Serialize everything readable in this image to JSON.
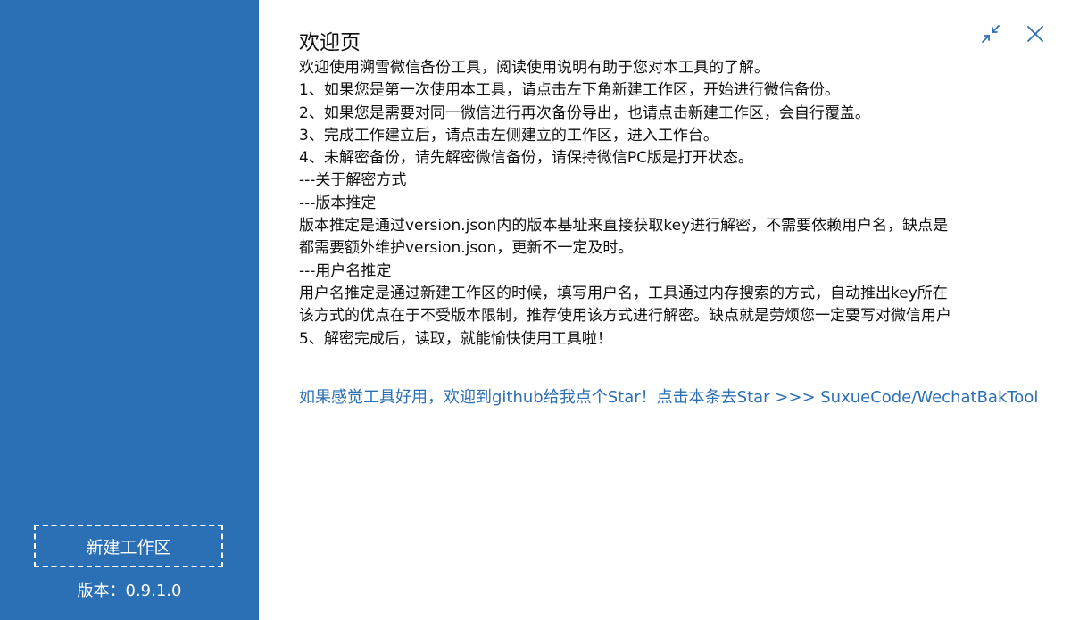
{
  "sidebar": {
    "new_workspace_label": "新建工作区",
    "version_label": "版本：",
    "version_value": "0.9.1.0"
  },
  "main": {
    "title": "欢迎页",
    "lines": [
      "欢迎使用溯雪微信备份工具，阅读使用说明有助于您对本工具的了解。",
      "1、如果您是第一次使用本工具，请点击左下角新建工作区，开始进行微信备份。",
      "2、如果您是需要对同一微信进行再次备份导出，也请点击新建工作区，会自行覆盖。",
      "3、完成工作建立后，请点击左侧建立的工作区，进入工作台。",
      "4、未解密备份，请先解密微信备份，请保持微信PC版是打开状态。",
      "---关于解密方式",
      "---版本推定",
      "版本推定是通过version.json内的版本基址来直接获取key进行解密，不需要依赖用户名，缺点是",
      "都需要额外维护version.json，更新不一定及时。",
      "---用户名推定",
      "用户名推定是通过新建工作区的时候，填写用户名，工具通过内存搜索的方式，自动推出key所在",
      "该方式的优点在于不受版本限制，推荐使用该方式进行解密。缺点就是劳烦您一定要写对微信用户",
      "5、解密完成后，读取，就能愉快使用工具啦！"
    ],
    "star_link": "如果感觉工具好用，欢迎到github给我点个Star！点击本条去Star >>> SuxueCode/WechatBakTool"
  },
  "window_controls": {
    "restore_icon": "restore-icon",
    "close_icon": "close-icon"
  },
  "colors": {
    "sidebar_bg": "#2b6fb4",
    "accent": "#2b6fb4",
    "text": "#111111"
  }
}
